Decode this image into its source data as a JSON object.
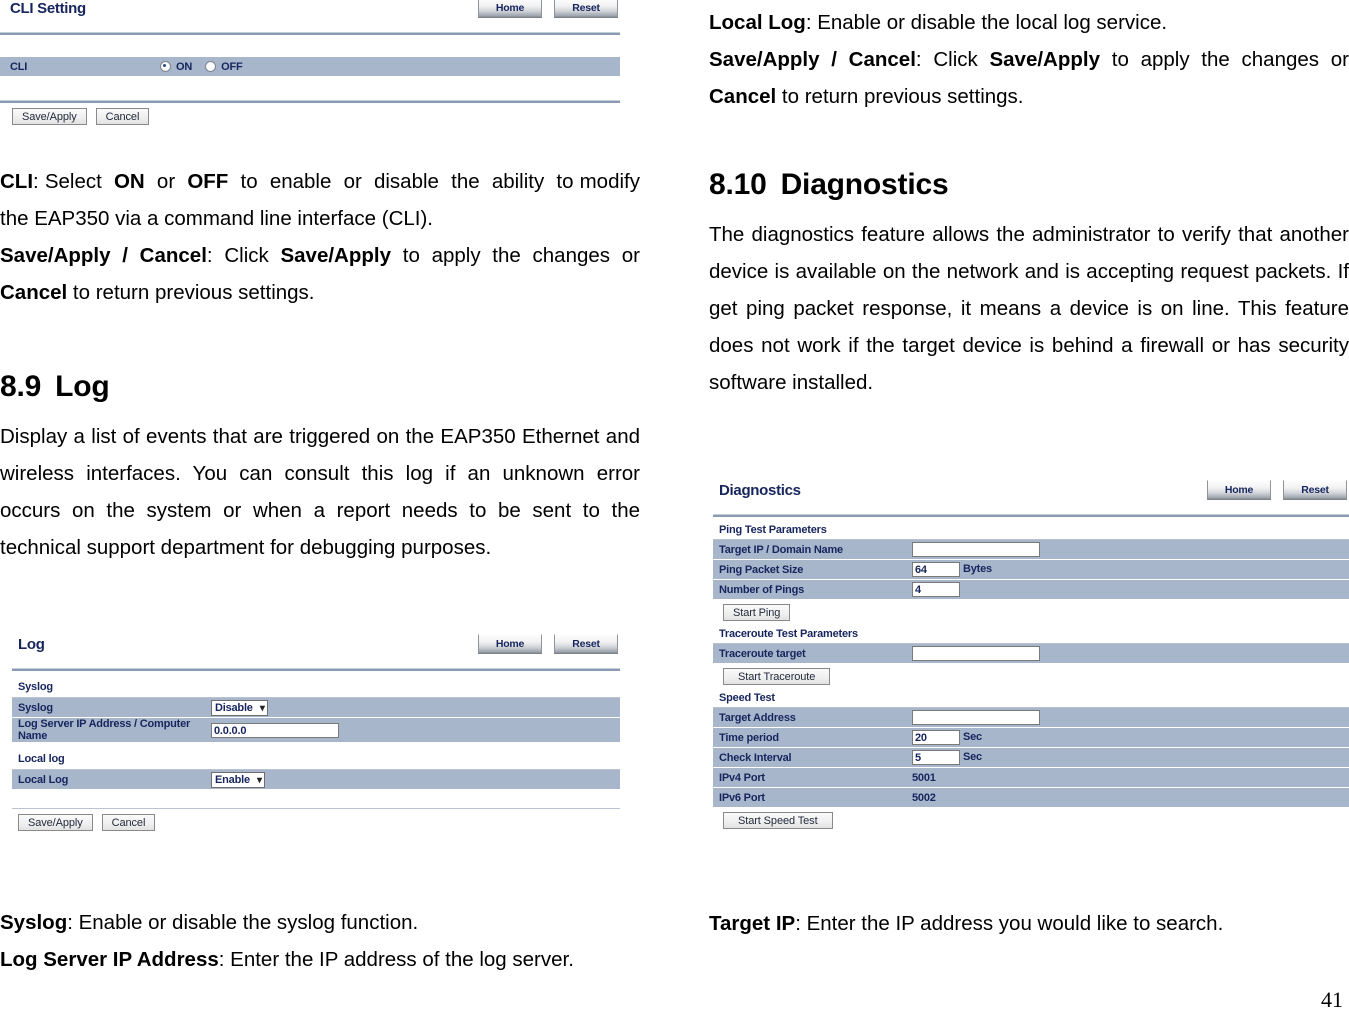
{
  "page_number": "41",
  "left_column": {
    "cli_panel": {
      "title": "CLI Setting",
      "home_label": "Home",
      "reset_label": "Reset",
      "row_label": "CLI",
      "radio_on": "ON",
      "radio_off": "OFF",
      "selected": "ON",
      "save_label": "Save/Apply",
      "cancel_label": "Cancel"
    },
    "cli_desc": {
      "p1_bold": "CLI",
      "p1": ": Select <b>ON</b> or <b>OFF</b> to enable or disable the ability to modify the EAP350 via a command line interface (CLI).",
      "p2": "<b>Save/Apply / Cancel</b>: Click <b>Save/Apply</b> to apply the changes or <b>Cancel</b> to return previous settings."
    },
    "log_heading": {
      "number": "8.9",
      "text": "Log"
    },
    "log_intro": "Display a list of events that are triggered on the EAP350 Ethernet and wireless interfaces. You can consult this log if an unknown error occurs on the system or when a report needs to be sent to the technical support department for debugging purposes.",
    "log_panel": {
      "title": "Log",
      "home_label": "Home",
      "reset_label": "Reset",
      "section_syslog": "Syslog",
      "section_local_log": "Local log",
      "rows": [
        {
          "label": "Syslog",
          "control": "select",
          "value": "Disable"
        },
        {
          "label": "Log Server IP Address / Computer Name",
          "control": "text",
          "value": "0.0.0.0"
        },
        {
          "label": "Local Log",
          "control": "select",
          "value": "Enable"
        }
      ],
      "save_label": "Save/Apply",
      "cancel_label": "Cancel"
    },
    "log_desc": {
      "p1": "<b>Syslog</b>: Enable or disable the syslog function.",
      "p2": "<b>Log Server IP Address</b>: Enter the IP address of the log server."
    }
  },
  "right_column": {
    "log_desc_cont": {
      "p1": "<b>Local Log</b>: Enable or disable the local log service.",
      "p2": "<b>Save/Apply / Cancel</b>: Click <b>Save/Apply</b> to apply the changes or <b>Cancel</b> to return previous settings."
    },
    "diag_heading": {
      "number": "8.10",
      "text": "Diagnostics"
    },
    "diag_intro": "The diagnostics feature allows the administrator to verify that another device is available on the network and is accepting request packets. If get ping packet response, it means a device is on line. This feature does not work if the target device is behind a firewall or has security software installed.",
    "diag_panel": {
      "title": "Diagnostics",
      "home_label": "Home",
      "reset_label": "Reset",
      "ping_section": "Ping Test Parameters",
      "ping_rows": [
        {
          "label": "Target IP / Domain Name",
          "control": "text-wide",
          "value": "",
          "unit": ""
        },
        {
          "label": "Ping Packet Size",
          "control": "text-small",
          "value": "64",
          "unit": "Bytes"
        },
        {
          "label": "Number of Pings",
          "control": "text-small",
          "value": "4",
          "unit": ""
        }
      ],
      "start_ping_label": "Start Ping",
      "traceroute_section": "Traceroute Test Parameters",
      "traceroute_rows": [
        {
          "label": "Traceroute target",
          "control": "text-wide",
          "value": "",
          "unit": ""
        }
      ],
      "start_traceroute_label": "Start Traceroute",
      "speed_section": "Speed Test",
      "speed_rows": [
        {
          "label": "Target Address",
          "control": "text-wide",
          "value": "",
          "unit": ""
        },
        {
          "label": "Time period",
          "control": "text-small",
          "value": "20",
          "unit": "Sec"
        },
        {
          "label": "Check Interval",
          "control": "text-small",
          "value": "5",
          "unit": "Sec"
        },
        {
          "label": "IPv4 Port",
          "control": "static",
          "value": "5001",
          "unit": ""
        },
        {
          "label": "IPv6 Port",
          "control": "static",
          "value": "5002",
          "unit": ""
        }
      ],
      "start_speed_label": "Start Speed Test"
    },
    "diag_desc": {
      "p1": "<b>Target IP</b>: Enter the IP address you would like to search."
    }
  }
}
